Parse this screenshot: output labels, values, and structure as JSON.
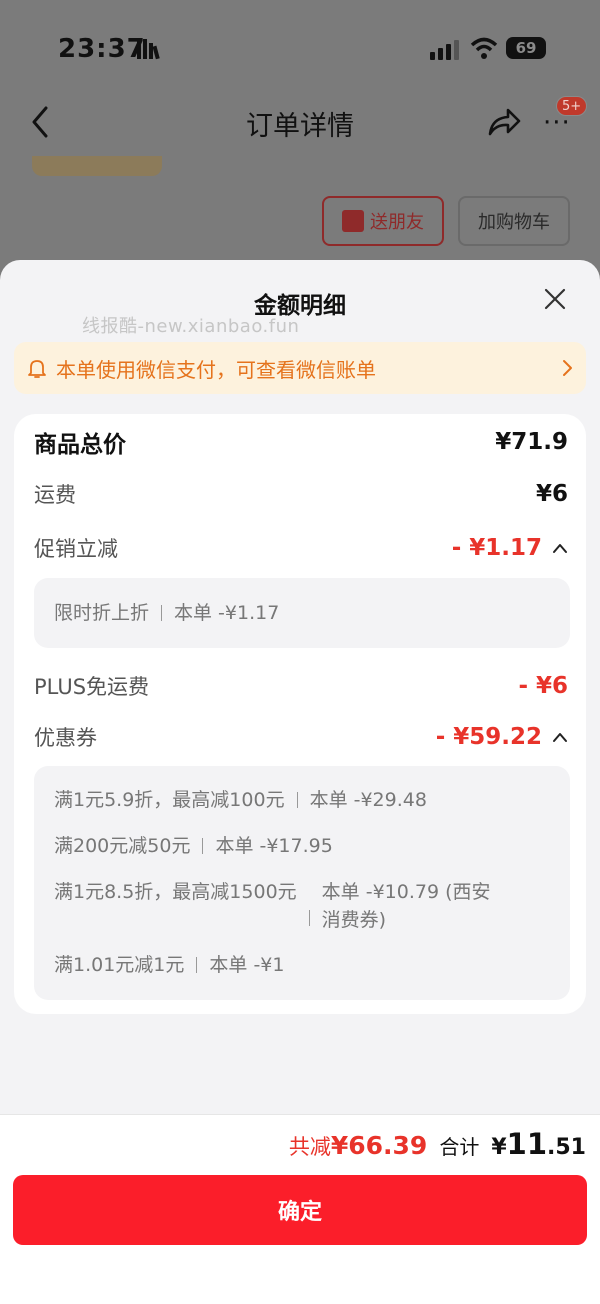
{
  "status_bar": {
    "time": "23:37",
    "battery": "69"
  },
  "nav": {
    "title": "订单详情",
    "badge": "5+"
  },
  "background": {
    "gift_label": "送朋友",
    "cart_label": "加购物车"
  },
  "sheet": {
    "title": "金额明细",
    "watermark": "线报酷-new.xianbao.fun",
    "wechat_notice": "本单使用微信支付，可查看微信账单"
  },
  "rows": {
    "goods_total": {
      "label": "商品总价",
      "value": "¥71.9"
    },
    "shipping": {
      "label": "运费",
      "value": "¥6"
    },
    "promo": {
      "label": "促销立减",
      "value": "- ¥1.17"
    },
    "plus_shipping": {
      "label": "PLUS免运费",
      "value": "- ¥6"
    },
    "coupon": {
      "label": "优惠券",
      "value": "- ¥59.22"
    }
  },
  "promo_details": [
    {
      "name": "限时折上折",
      "amount": "本单 -¥1.17"
    }
  ],
  "coupon_details": [
    {
      "name": "满1元5.9折，最高减100元",
      "amount": "本单 -¥29.48"
    },
    {
      "name": "满200元减50元",
      "amount": "本单 -¥17.95"
    },
    {
      "name": "满1元8.5折，最高减1500元",
      "amount": "本单 -¥10.79 (西安消费券)"
    },
    {
      "name": "满1.01元减1元",
      "amount": "本单 -¥1"
    }
  ],
  "footer": {
    "saved_label": "共减",
    "saved_amount": "¥66.39",
    "total_label": "合计",
    "total_currency": "¥",
    "total_int": "11",
    "total_dec": ".51",
    "confirm_label": "确定"
  },
  "colors": {
    "accent_red": "#fb1e2a",
    "price_red": "#e8332a",
    "notice_orange": "#e5731c"
  }
}
